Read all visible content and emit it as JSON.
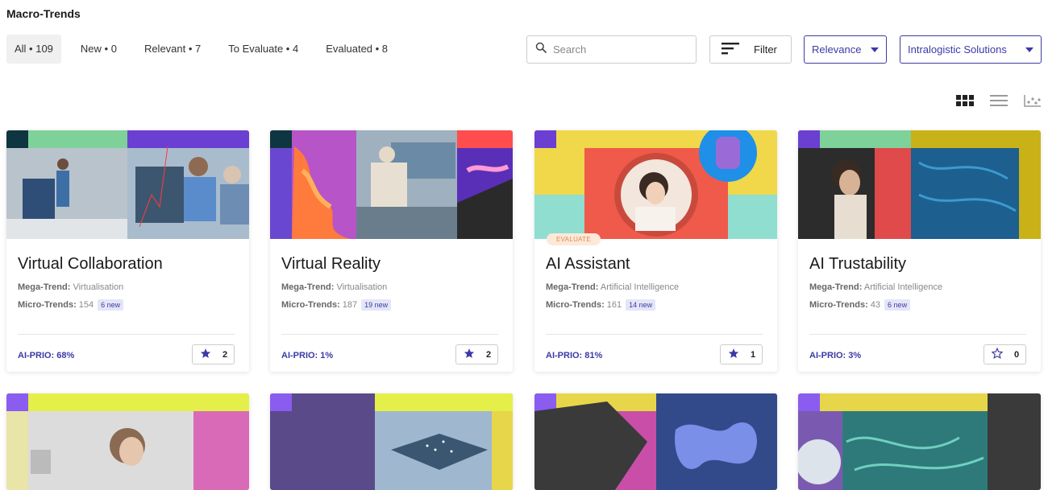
{
  "page": {
    "title": "Macro-Trends"
  },
  "tabs": [
    {
      "label": "All • 109"
    },
    {
      "label": "New • 0"
    },
    {
      "label": "Relevant • 7"
    },
    {
      "label": "To Evaluate • 4"
    },
    {
      "label": "Evaluated • 8"
    }
  ],
  "search": {
    "placeholder": "Search",
    "icon": "search-icon"
  },
  "filter": {
    "label": "Filter",
    "icon": "filter-lines-icon"
  },
  "sort_select": {
    "value": "Relevance"
  },
  "solution_select": {
    "value": "Intralogistic Solutions"
  },
  "view_icons": [
    "grid-view-icon",
    "list-view-icon",
    "scatter-view-icon"
  ],
  "colors": {
    "accent": "#3b3aa6",
    "badge_bg": "#fde9d9",
    "badge_text": "#e08a4f"
  },
  "cards": [
    {
      "title": "Virtual Collaboration",
      "mega_label": "Mega-Trend:",
      "mega": "Virtualisation",
      "micro_label": "Micro-Trends:",
      "micro": "154",
      "new": "6 new",
      "prio": "AI-PRIO: 68%",
      "stars": "2",
      "starred": true,
      "badge": ""
    },
    {
      "title": "Virtual Reality",
      "mega_label": "Mega-Trend:",
      "mega": "Virtualisation",
      "micro_label": "Micro-Trends:",
      "micro": "187",
      "new": "19 new",
      "prio": "AI-PRIO: 1%",
      "stars": "2",
      "starred": true,
      "badge": ""
    },
    {
      "title": "AI Assistant",
      "mega_label": "Mega-Trend:",
      "mega": "Artificial Intelligence",
      "micro_label": "Micro-Trends:",
      "micro": "161",
      "new": "14 new",
      "prio": "AI-PRIO: 81%",
      "stars": "1",
      "starred": true,
      "badge": "EVALUATE"
    },
    {
      "title": "AI Trustability",
      "mega_label": "Mega-Trend:",
      "mega": "Artificial Intelligence",
      "micro_label": "Micro-Trends:",
      "micro": "43",
      "new": "6 new",
      "prio": "AI-PRIO: 3%",
      "stars": "0",
      "starred": false,
      "badge": ""
    }
  ]
}
